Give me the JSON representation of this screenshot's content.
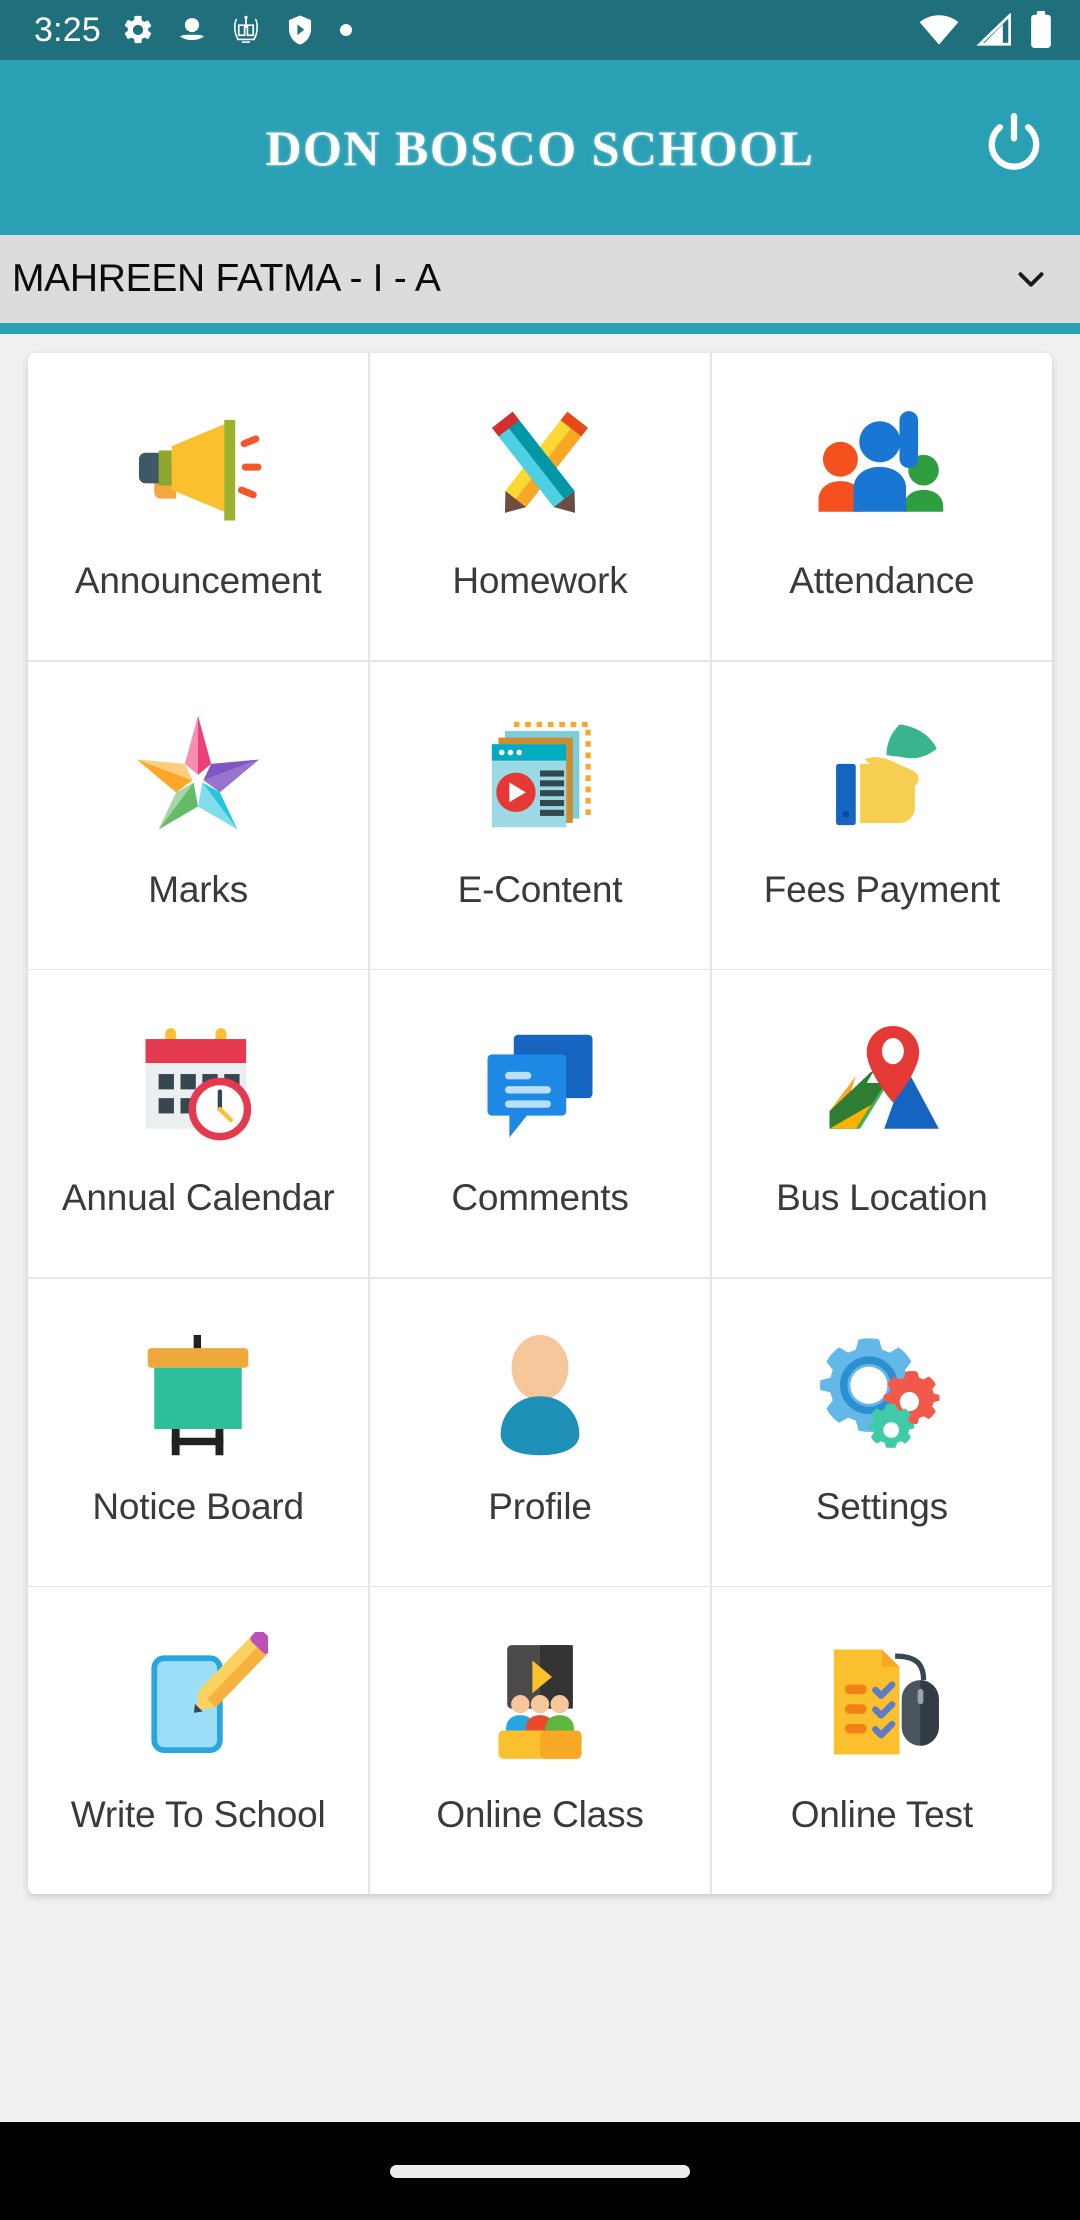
{
  "status_bar": {
    "time": "3:25",
    "left_icons": [
      "gear-icon",
      "person-badge-icon",
      "school-crest-icon",
      "shield-play-icon",
      "dot-icon"
    ],
    "right_icons": [
      "wifi-icon",
      "cellular-signal-icon",
      "battery-icon"
    ],
    "background_color": "#1F6F7D"
  },
  "app_bar": {
    "title": "DON BOSCO SCHOOL",
    "logout_icon": "power-icon",
    "background_color": "#2AA0B5"
  },
  "student_selector": {
    "selected_value": "MAHREEN FATMA - I - A",
    "caret_icon": "chevron-down-icon",
    "background_color": "#DCDCDC"
  },
  "page": {
    "background_color": "#F0F0F0",
    "accent_color": "#2AA0B5"
  },
  "menu": {
    "columns": 3,
    "items": [
      {
        "label": "Announcement",
        "icon": "megaphone-icon"
      },
      {
        "label": "Homework",
        "icon": "crossed-pencils-icon"
      },
      {
        "label": "Attendance",
        "icon": "people-raised-hand-icon"
      },
      {
        "label": "Marks",
        "icon": "star-icon"
      },
      {
        "label": "E-Content",
        "icon": "media-documents-icon"
      },
      {
        "label": "Fees Payment",
        "icon": "hand-money-icon"
      },
      {
        "label": "Annual Calendar",
        "icon": "calendar-clock-icon"
      },
      {
        "label": "Comments",
        "icon": "chat-bubbles-icon"
      },
      {
        "label": "Bus Location",
        "icon": "map-pin-icon"
      },
      {
        "label": "Notice Board",
        "icon": "easel-board-icon"
      },
      {
        "label": "Profile",
        "icon": "person-avatar-icon"
      },
      {
        "label": "Settings",
        "icon": "gears-icon"
      },
      {
        "label": "Write To School",
        "icon": "note-pencil-icon"
      },
      {
        "label": "Online Class",
        "icon": "screen-students-icon"
      },
      {
        "label": "Online Test",
        "icon": "checklist-mouse-icon"
      }
    ]
  },
  "navigation_bar": {
    "home_indicator": "home-indicator-pill",
    "background_color": "#000000"
  }
}
